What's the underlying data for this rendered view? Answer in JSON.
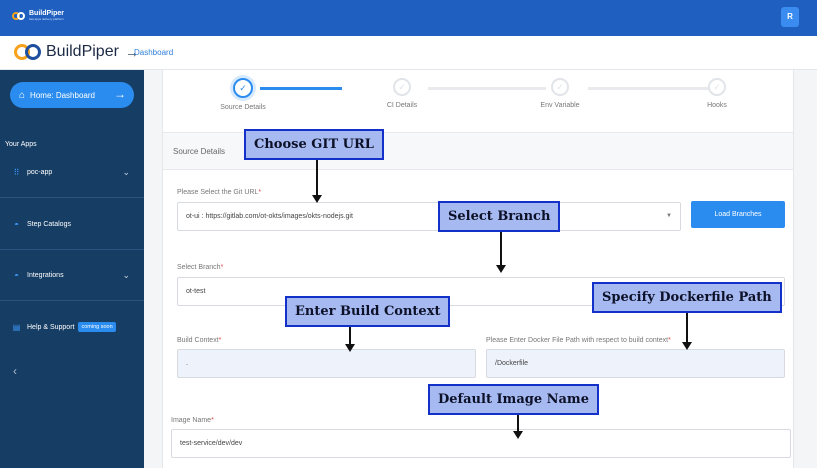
{
  "topbar": {
    "logo_text": "BuildPiper",
    "logo_tagline": "fast apps delivery platform",
    "avatar": "R"
  },
  "header": {
    "brand": "BuildPiper",
    "brand_arrow": "→",
    "breadcrumb": "Dashboard"
  },
  "sidebar": {
    "home_label": "Home: Dashboard",
    "home_arrow": "→",
    "your_apps": "Your Apps",
    "items": [
      {
        "label": "poc-app",
        "icon": "grid-icon"
      },
      {
        "label": "Step Catalogs",
        "icon": "basket-icon"
      },
      {
        "label": "Integrations",
        "icon": "basket-icon"
      },
      {
        "label": "Help & Support",
        "icon": "document-icon",
        "badge": "coming soon"
      }
    ],
    "collapse": "‹"
  },
  "stepper": {
    "steps": [
      {
        "label": "Source Details",
        "state": "active"
      },
      {
        "label": "CI Details",
        "state": "pending"
      },
      {
        "label": "Env Variable",
        "state": "pending"
      },
      {
        "label": "Hooks",
        "state": "pending"
      }
    ],
    "check_glyph": "✓"
  },
  "form": {
    "section_title": "Source Details",
    "git_url": {
      "label": "Please Select the Git URL",
      "value": "ot-ui : https://gitlab.com/ot-okts/images/okts-nodejs.git"
    },
    "load_branches": "Load Branches",
    "branch": {
      "label": "Select Branch",
      "value": "ot-test"
    },
    "build_context": {
      "label": "Build Context",
      "value": "."
    },
    "dockerfile_path": {
      "label": "Please Enter Docker File Path with respect to build context",
      "value": "/Dockerfile"
    },
    "image_name": {
      "label": "Image Name",
      "value": "test-service/dev/dev"
    },
    "required_mark": "*"
  },
  "annotations": {
    "git_url": "Choose GIT URL",
    "branch": "Select Branch",
    "build_context": "Enter Build Context",
    "dockerfile": "Specify Dockerfile Path",
    "image_name": "Default Image Name"
  },
  "colors": {
    "primary": "#2b8cf0",
    "topbar": "#1f5fbf",
    "sidebar": "#163d64",
    "annotation_fill": "#a6b9f0",
    "annotation_border": "#1330c9"
  }
}
